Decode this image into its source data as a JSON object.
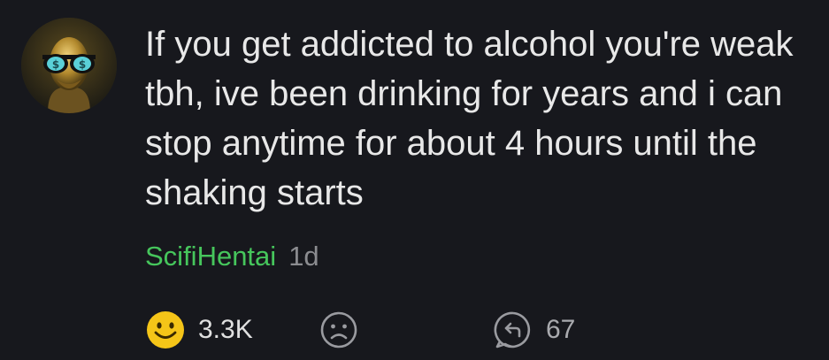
{
  "comment": {
    "text": "If you get addicted to alcohol you're weak tbh, ive been drinking for years and i can stop anytime for about 4 hours until the shaking starts",
    "author": "ScifiHentai",
    "time": "1d"
  },
  "actions": {
    "upvote_count": "3.3K",
    "reply_count": "67"
  },
  "icons": {
    "avatar": "avatar-image",
    "upvote": "smiley-face-icon",
    "downvote": "sad-face-icon",
    "reply": "reply-icon"
  },
  "colors": {
    "background": "#17181d",
    "text": "#e8e8e8",
    "author": "#46c65c",
    "time": "#8b8c90",
    "smiley": "#f5c518",
    "muted_icon": "#9a9ba0"
  }
}
